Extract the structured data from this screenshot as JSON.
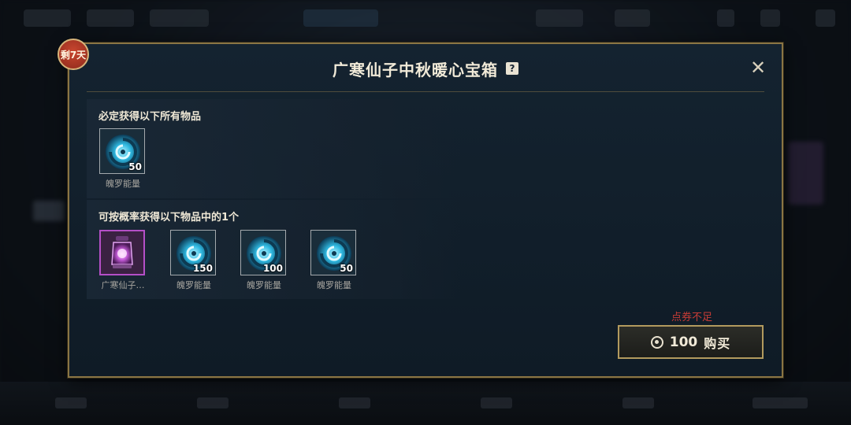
{
  "badge": {
    "countdown": "剩7天"
  },
  "dialog": {
    "title": "广寒仙子中秋暖心宝箱",
    "help_icon": "question-mark-icon",
    "close_icon": "close-icon"
  },
  "guaranteed": {
    "label": "必定获得以下所有物品",
    "items": [
      {
        "name": "魄罗能量",
        "quantity": "50",
        "icon": "poro-energy-swirl-icon"
      }
    ]
  },
  "random": {
    "label": "可按概率获得以下物品中的1个",
    "items": [
      {
        "name": "广寒仙子…",
        "quantity": "",
        "icon": "purple-lantern-icon"
      },
      {
        "name": "魄罗能量",
        "quantity": "150",
        "icon": "poro-energy-swirl-icon"
      },
      {
        "name": "魄罗能量",
        "quantity": "100",
        "icon": "poro-energy-swirl-icon"
      },
      {
        "name": "魄罗能量",
        "quantity": "50",
        "icon": "poro-energy-swirl-icon"
      }
    ]
  },
  "purchase": {
    "warning": "点券不足",
    "price": "100",
    "button_label": "购买",
    "currency_icon": "coupon-icon"
  },
  "colors": {
    "frame_gold": "#8a7544",
    "warning_red": "#c73c36",
    "rare_purple": "#b44fc7",
    "energy_cyan": "#3fc6e6"
  }
}
